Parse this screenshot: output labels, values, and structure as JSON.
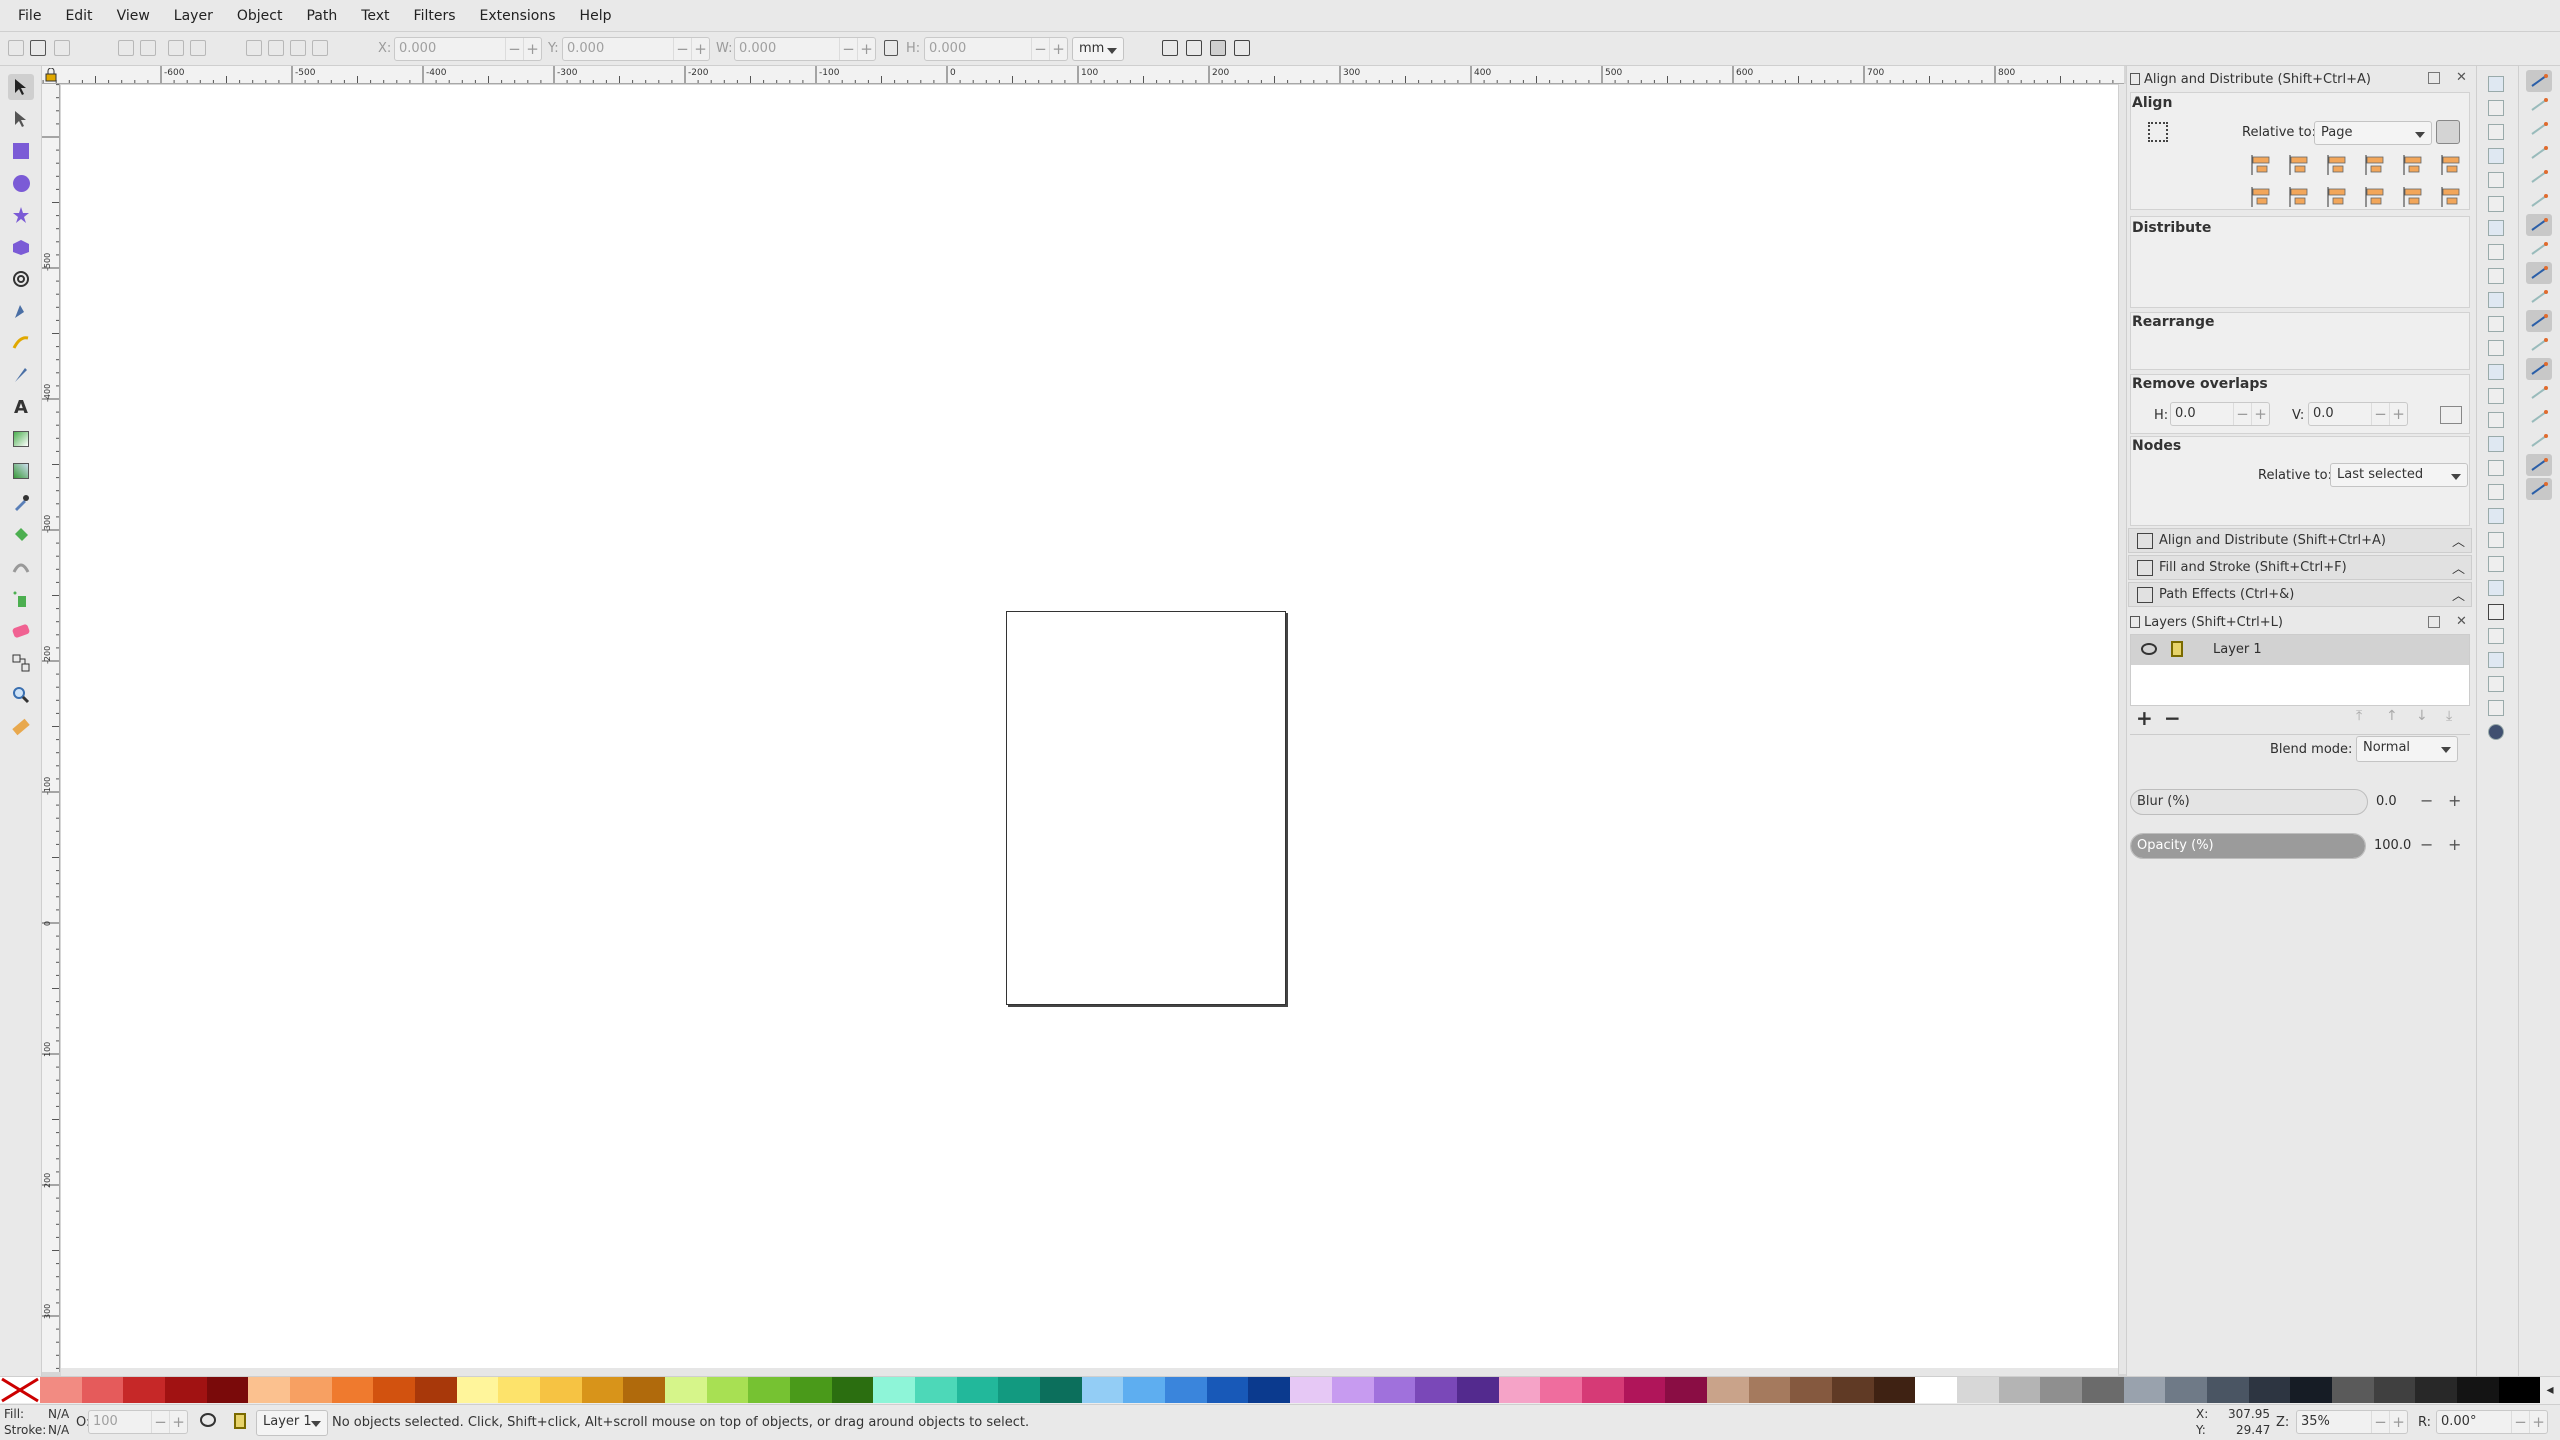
{
  "menu": [
    "File",
    "Edit",
    "View",
    "Layer",
    "Object",
    "Path",
    "Text",
    "Filters",
    "Extensions",
    "Help"
  ],
  "toolctrl": {
    "x_label": "X:",
    "x_value": "0.000",
    "y_label": "Y:",
    "y_value": "0.000",
    "w_label": "W:",
    "w_value": "0.000",
    "h_label": "H:",
    "h_value": "0.000",
    "unit": "mm"
  },
  "ruler": {
    "h_ticks": [
      "-600",
      "-500",
      "-400",
      "-300",
      "-200",
      "-100",
      "0",
      "100",
      "200",
      "300",
      "400",
      "500",
      "600",
      "700",
      "800"
    ],
    "v_ticks": [
      "-500",
      "-400",
      "-300",
      "-200",
      "-100",
      "0",
      "100",
      "200",
      "300"
    ]
  },
  "dock": {
    "title": "Align and Distribute (Shift+Ctrl+A)",
    "align": {
      "heading": "Align",
      "relative_label": "Relative to:",
      "relative_value": "Page"
    },
    "distribute_heading": "Distribute",
    "rearrange_heading": "Rearrange",
    "remove_overlaps": {
      "heading": "Remove overlaps",
      "h_label": "H:",
      "h_value": "0.0",
      "v_label": "V:",
      "v_value": "0.0"
    },
    "nodes": {
      "heading": "Nodes",
      "relative_label": "Relative to:",
      "relative_value": "Last selected"
    },
    "collapsed_panels": [
      "Align and Distribute (Shift+Ctrl+A)",
      "Fill and Stroke (Shift+Ctrl+F)",
      "Path Effects (Ctrl+&)"
    ],
    "layers": {
      "title": "Layers (Shift+Ctrl+L)",
      "layer_name": "Layer 1",
      "blend_label": "Blend mode:",
      "blend_value": "Normal",
      "blur_label": "Blur (%)",
      "blur_value": "0.0",
      "blur_level": 0.0,
      "opacity_label": "Opacity (%)",
      "opacity_value": "100.0",
      "opacity_level": 1.0
    }
  },
  "palette": {
    "colors": [
      "#f28b82",
      "#e55b5b",
      "#c62828",
      "#a11212",
      "#7a0a0a",
      "#fbc18f",
      "#f7a062",
      "#ef7a2e",
      "#d2520f",
      "#a8380a",
      "#fff59b",
      "#fde36b",
      "#f6c343",
      "#d8941a",
      "#b06a0c",
      "#d6f58a",
      "#a8e053",
      "#76c232",
      "#4a9a1a",
      "#2b6e10",
      "#8ef5d8",
      "#4dd8b8",
      "#22b89b",
      "#129a80",
      "#0c6f5c",
      "#93cdf5",
      "#5eaef0",
      "#3a85dc",
      "#1859b8",
      "#0b3a8e",
      "#e6c8f5",
      "#c79bf0",
      "#a071dc",
      "#7a48b8",
      "#532a8e",
      "#f5a3c7",
      "#ef6d9e",
      "#d63a76",
      "#b0155a",
      "#8a0d44",
      "#c9a38a",
      "#a57a5e",
      "#85593f",
      "#603a25",
      "#3f2213",
      "#ffffff",
      "#d7d7d7",
      "#b4b4b4",
      "#8f8f8f",
      "#6b6b6b",
      "#99a2ad",
      "#6f7a87",
      "#4a5563",
      "#2d3541",
      "#161c25",
      "#5a5a5a",
      "#404040",
      "#282828",
      "#141414",
      "#000000"
    ]
  },
  "status": {
    "fill_label": "Fill:",
    "fill_value": "N/A",
    "stroke_label": "Stroke:",
    "stroke_value": "N/A",
    "opacity_label": "O:",
    "opacity_value": "100",
    "layer": "Layer 1",
    "message": "No objects selected. Click, Shift+click, Alt+scroll mouse on top of objects, or drag around objects to select.",
    "x_label": "X:",
    "x_value": "307.95",
    "y_label": "Y:",
    "y_value": "29.47",
    "zoom_label": "Z:",
    "zoom_value": "35%",
    "rot_label": "R:",
    "rot_value": "0.00°"
  }
}
